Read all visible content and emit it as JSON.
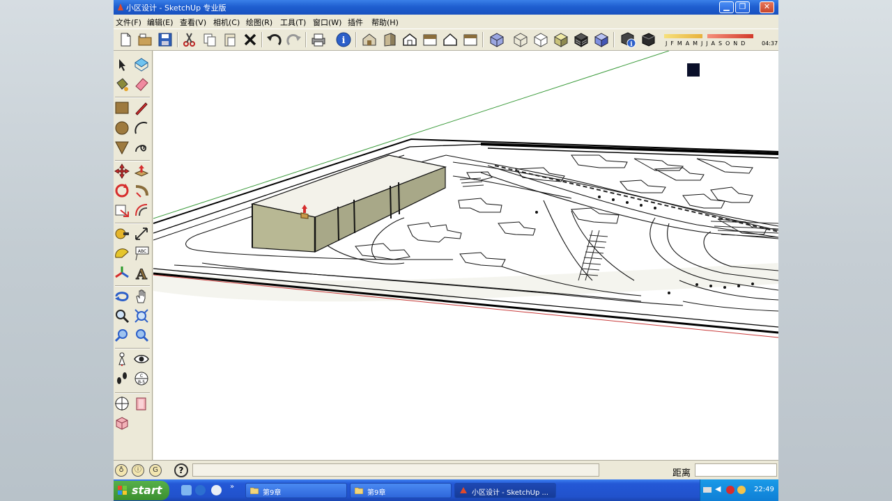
{
  "window": {
    "title": "小区设计 - SketchUp 专业版",
    "buttons": [
      "minimize",
      "maximize",
      "close"
    ]
  },
  "menu": [
    "文件(F)",
    "编辑(E)",
    "查看(V)",
    "相机(C)",
    "绘图(R)",
    "工具(T)",
    "窗口(W)",
    "插件",
    "帮助(H)"
  ],
  "shadow_settings": {
    "months": "J F M A M J J A S O N D",
    "time": "04:37"
  },
  "statusbar": {
    "measurement_label": "距离",
    "measurement_value": ""
  },
  "taskbar": {
    "start_label": "start",
    "tasks": [
      "第9章",
      "第9章",
      "小区设计 - SketchUp ..."
    ],
    "clock": "22:49"
  }
}
